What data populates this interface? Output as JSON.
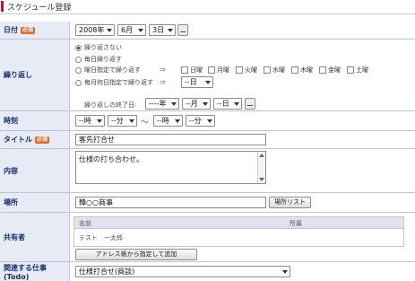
{
  "page": {
    "title": "スケジュール登録"
  },
  "required_badge": "必須",
  "date": {
    "label": "日付",
    "year": "2008年",
    "month": "6月",
    "day": "3日"
  },
  "repeat": {
    "label": "繰り返し",
    "options": [
      {
        "label": "繰り返さない",
        "selected": true
      },
      {
        "label": "毎日繰り返す",
        "selected": false
      },
      {
        "label": "曜日指定で繰り返す",
        "selected": false
      },
      {
        "label": "毎月何日指定で繰り返す",
        "selected": false
      }
    ],
    "arrow": "⇒",
    "weekdays": [
      "日曜",
      "月曜",
      "火曜",
      "水曜",
      "木曜",
      "金曜",
      "土曜"
    ],
    "monthday": "--日",
    "end_label": "繰り返しの終了日:",
    "end_year": "----年",
    "end_month": "--月",
    "end_day": "--日"
  },
  "time": {
    "label": "時刻",
    "start_hour": "--時",
    "start_min": "--分",
    "tilde": "～",
    "end_hour": "--時",
    "end_min": "--分"
  },
  "subject": {
    "label": "タイトル",
    "value": "客先打合せ"
  },
  "detail": {
    "label": "内容",
    "value": "仕様の打ち合わせ。"
  },
  "place": {
    "label": "場所",
    "value": "韓○○商事",
    "list_button": "場所リスト"
  },
  "share": {
    "label": "共有者",
    "col_name": "名前",
    "col_dept": "所属",
    "rows": [
      {
        "name": "テスト　一太郎",
        "dept": ""
      }
    ],
    "add_button": "アドレス帳から指定して追加"
  },
  "todo": {
    "label": "関連する仕事(Todo)",
    "value": "仕様打合せ(商談)"
  }
}
